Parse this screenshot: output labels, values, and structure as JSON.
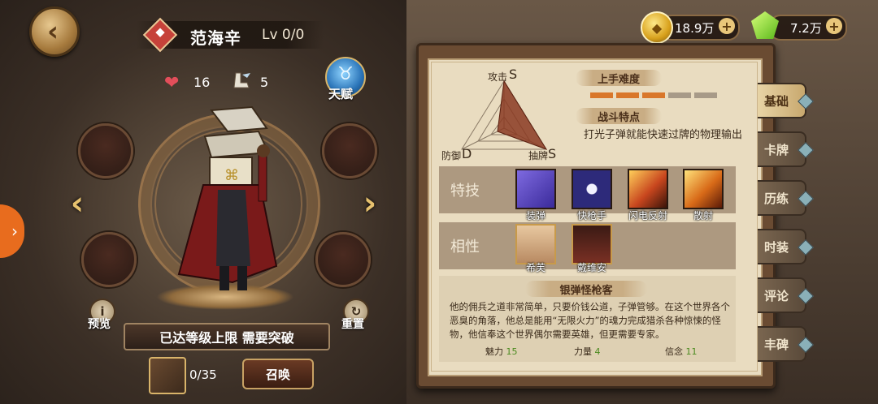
{
  "hero": {
    "name": "范海辛",
    "level": "Lv 0/0",
    "hearts": "16",
    "boots": "5"
  },
  "talent_label": "天赋",
  "preview_label": "预览",
  "reset_label": "重置",
  "status_text": "已达等级上限 需要突破",
  "shards": "0/35",
  "summon_label": "召唤",
  "currency": {
    "gold": "18.9万",
    "gems": "7.2万"
  },
  "radar": {
    "attack_label": "攻击",
    "attack_grade": "S",
    "defense_label": "防御",
    "defense_grade": "D",
    "draw_label": "抽牌",
    "draw_grade": "S"
  },
  "difficulty": {
    "title": "上手难度",
    "filled": 3,
    "total": 5
  },
  "feature": {
    "title": "战斗特点",
    "text": "打光子弹就能快速过牌的物理输出"
  },
  "skills": {
    "label": "特技",
    "items": [
      {
        "name": "装弹",
        "color": "#5b49c8"
      },
      {
        "name": "快枪手",
        "color": "#2d2a7a"
      },
      {
        "name": "闪电反射",
        "color": "#c8461e"
      },
      {
        "name": "散射",
        "color": "#d86a18"
      }
    ]
  },
  "affinity": {
    "label": "相性",
    "items": [
      {
        "name": "希芙",
        "color": "#d8b28a"
      },
      {
        "name": "戴维安",
        "color": "#6a2a22"
      }
    ]
  },
  "bio": {
    "title": "银弹怪枪客",
    "text": "他的佣兵之道非常简单，只要价钱公道，子弹管够。在这个世界各个恶臭的角落，他总是能用“无限火力”的魂力完成猎杀各种惊悚的怪物，他信奉这个世界偶尔需要英雄，但更需要专家。",
    "charm_label": "魅力",
    "charm": "15",
    "strength_label": "力量",
    "strength": "4",
    "faith_label": "信念",
    "faith": "11"
  },
  "tabs": [
    "基础",
    "卡牌",
    "历练",
    "时装",
    "评论",
    "丰碑"
  ],
  "active_tab": 0
}
